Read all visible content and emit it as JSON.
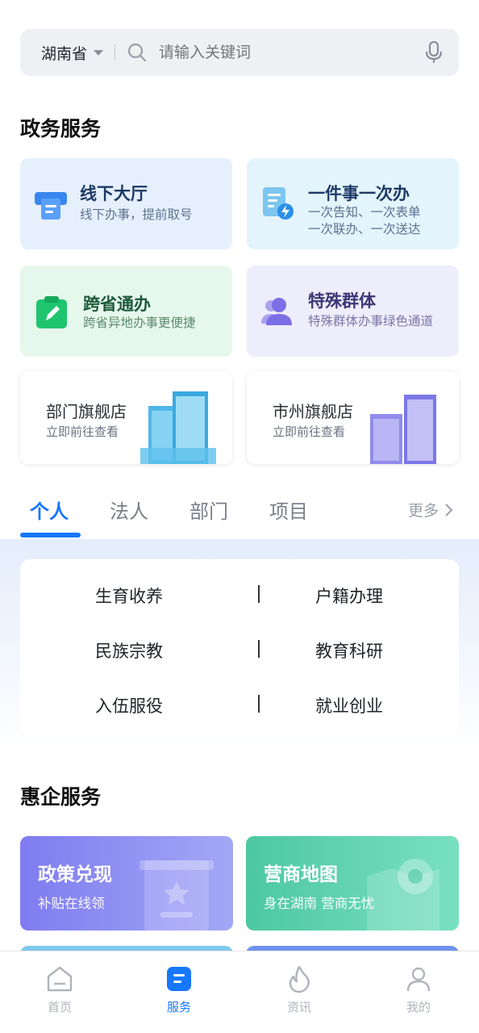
{
  "search": {
    "region": "湖南省",
    "placeholder": "请输入关键词"
  },
  "gov_section": {
    "title": "政务服务",
    "cards": [
      {
        "title": "线下大厅",
        "subtitle": "线下办事，提前取号"
      },
      {
        "title": "一件事一次办",
        "subtitle_line1": "一次告知、一次表单",
        "subtitle_line2": "一次联办、一次送达"
      },
      {
        "title": "跨省通办",
        "subtitle": "跨省异地办事更便捷"
      },
      {
        "title": "特殊群体",
        "subtitle": "特殊群体办事绿色通道"
      }
    ],
    "shops": [
      {
        "title": "部门旗舰店",
        "subtitle": "立即前往查看"
      },
      {
        "title": "市州旗舰店",
        "subtitle": "立即前往查看"
      }
    ]
  },
  "tabs": {
    "items": [
      "个人",
      "法人",
      "部门",
      "项目"
    ],
    "active": "个人",
    "more": "更多"
  },
  "categories": [
    "生育收养",
    "户籍办理",
    "民族宗教",
    "教育科研",
    "入伍服役",
    "就业创业"
  ],
  "benefit_section": {
    "title": "惠企服务",
    "cards": [
      {
        "title": "政策兑现",
        "subtitle": "补贴在线领"
      },
      {
        "title": "营商地图",
        "subtitle": "身在湖南 营商无忧"
      }
    ]
  },
  "bottom_nav": {
    "items": [
      "首页",
      "服务",
      "资讯",
      "我的"
    ],
    "active": "服务"
  },
  "colors": {
    "accent": "#1677ff",
    "card_blue": "#e6f0fd",
    "card_cyan": "#e3f4fc",
    "card_green": "#e6f8ec",
    "card_purple": "#eeedfb"
  }
}
